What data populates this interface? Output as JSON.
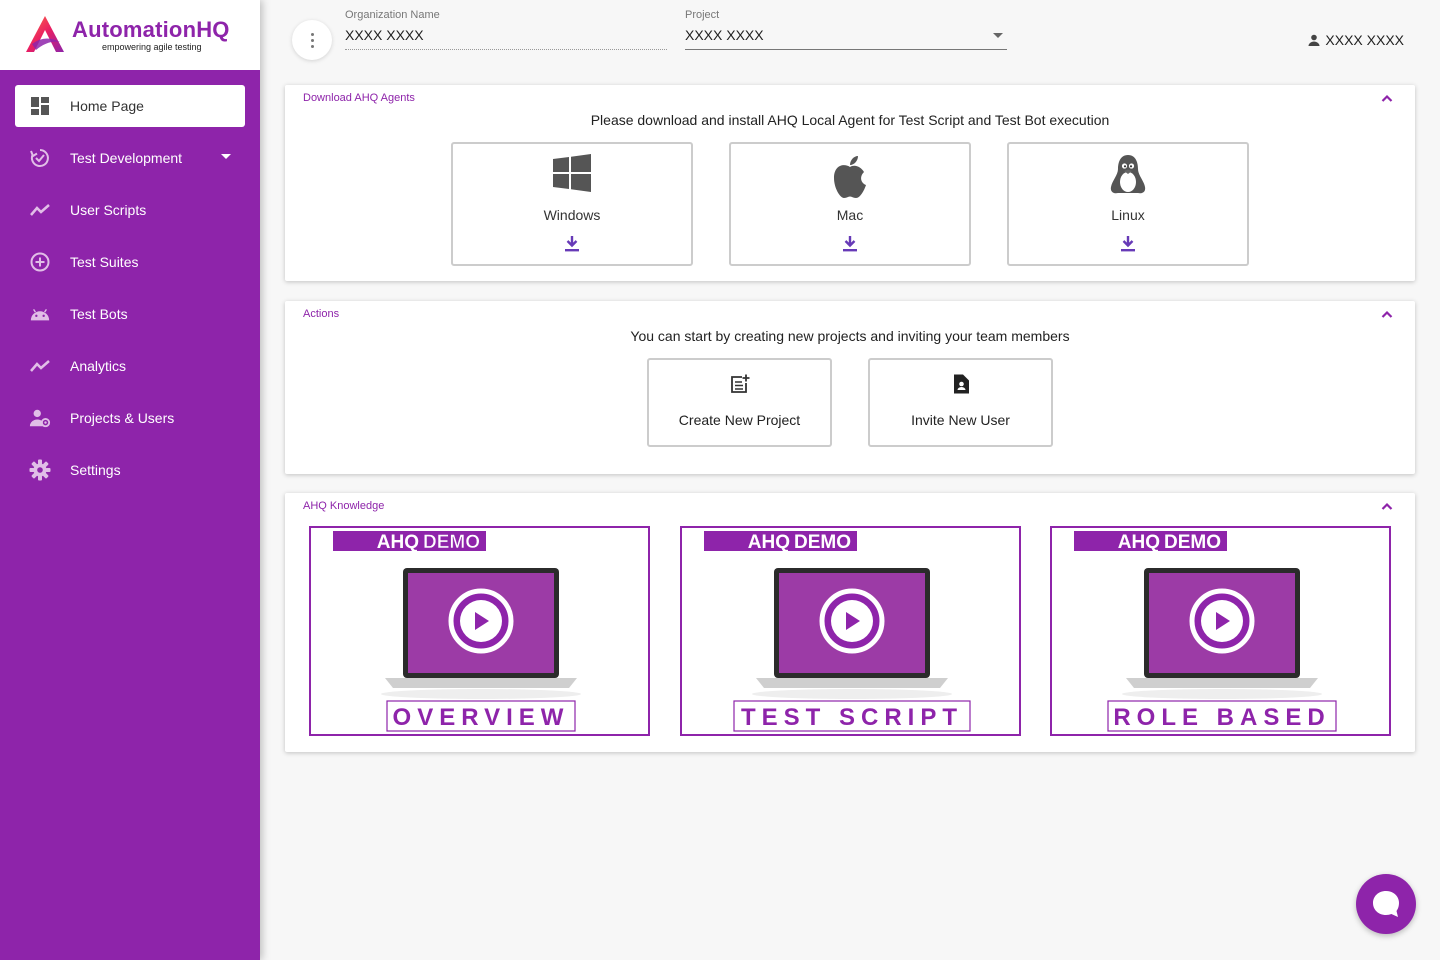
{
  "brand": {
    "title": "AutomationHQ",
    "tagline": "empowering agile testing",
    "accent": "#8e24aa"
  },
  "sidebar": {
    "items": [
      {
        "label": "Home Page",
        "icon": "dashboard-icon",
        "active": true
      },
      {
        "label": "Test Development",
        "icon": "sync-check-icon",
        "has_caret": true
      },
      {
        "label": "User Scripts",
        "icon": "trend-line-icon"
      },
      {
        "label": "Test Suites",
        "icon": "add-circle-icon"
      },
      {
        "label": "Test Bots",
        "icon": "android-icon"
      },
      {
        "label": "Analytics",
        "icon": "trend-line-icon"
      },
      {
        "label": "Projects & Users",
        "icon": "user-settings-icon"
      },
      {
        "label": "Settings",
        "icon": "gear-icon"
      }
    ]
  },
  "header": {
    "org_label": "Organization Name",
    "org_value": "XXXX XXXX",
    "project_label": "Project",
    "project_value": "XXXX XXXX",
    "user_name": "XXXX XXXX"
  },
  "download_card": {
    "title": "Download AHQ Agents",
    "description": "Please download and install AHQ Local Agent for Test Script and Test Bot execution",
    "agents": [
      {
        "label": "Windows",
        "icon": "windows-icon"
      },
      {
        "label": "Mac",
        "icon": "apple-icon"
      },
      {
        "label": "Linux",
        "icon": "linux-icon"
      }
    ]
  },
  "actions_card": {
    "title": "Actions",
    "description": "You can start by creating new projects and inviting your team members",
    "buttons": [
      {
        "label": "Create New Project",
        "icon": "new-document-icon"
      },
      {
        "label": "Invite New User",
        "icon": "user-file-icon"
      }
    ]
  },
  "knowledge_card": {
    "title": "AHQ Knowledge",
    "videos": [
      {
        "brand_left": "AHQ",
        "brand_right": "DEMO",
        "caption": "OVERVIEW"
      },
      {
        "brand_left": "AHQ",
        "brand_right": "DEMO",
        "caption": "TEST SCRIPT"
      },
      {
        "brand_left": "AHQ",
        "brand_right": "DEMO",
        "caption": "ROLE BASED"
      }
    ]
  }
}
